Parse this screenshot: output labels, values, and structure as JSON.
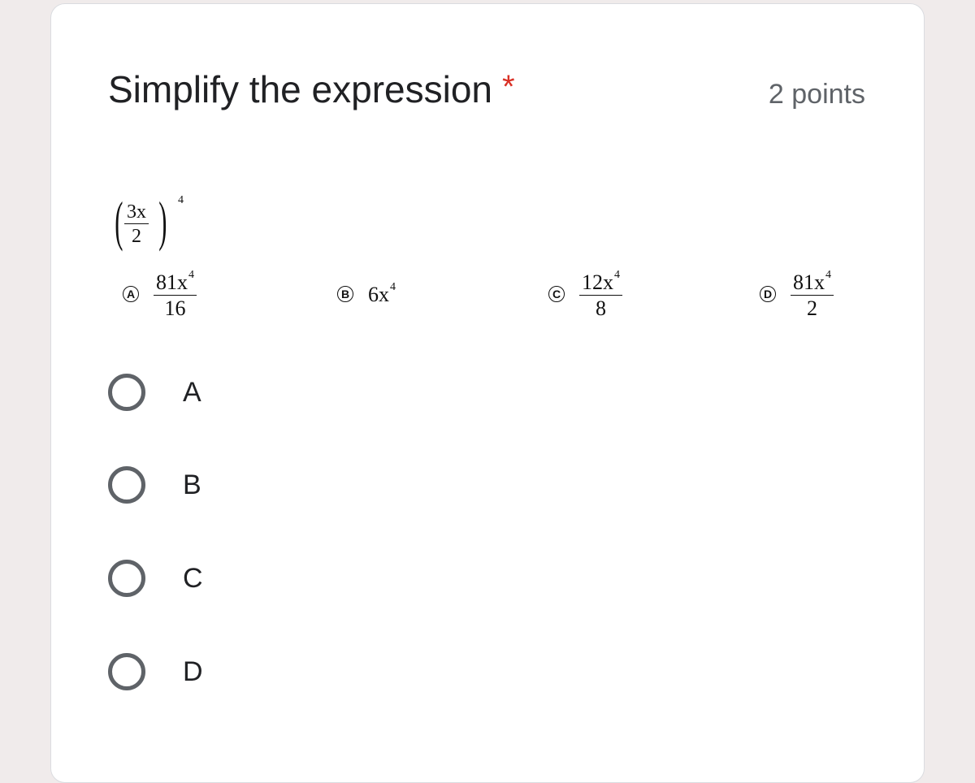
{
  "question": {
    "title": "Simplify the expression",
    "required_mark": "*",
    "points": "2 points"
  },
  "problem": {
    "numerator": "3x",
    "denominator": "2",
    "exponent": "4",
    "answer_choices": [
      {
        "letter": "A",
        "numerator": "81x",
        "exponent": "4",
        "denominator": "16"
      },
      {
        "letter": "B",
        "expression": "6x",
        "exponent": "4"
      },
      {
        "letter": "C",
        "numerator": "12x",
        "exponent": "4",
        "denominator": "8"
      },
      {
        "letter": "D",
        "numerator": "81x",
        "exponent": "4",
        "denominator": "2"
      }
    ]
  },
  "options": [
    {
      "label": "A",
      "selected": false
    },
    {
      "label": "B",
      "selected": false
    },
    {
      "label": "C",
      "selected": false
    },
    {
      "label": "D",
      "selected": false
    }
  ],
  "colors": {
    "background": "#f0ebeb",
    "card": "#ffffff",
    "required": "#d93025",
    "radio_border": "#5f6368",
    "text": "#202124"
  }
}
